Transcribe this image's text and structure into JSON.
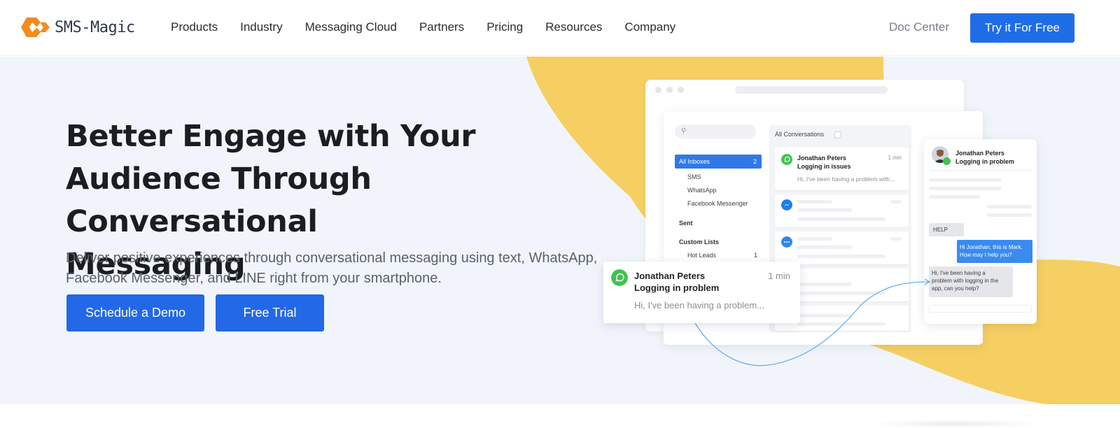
{
  "brand": {
    "name": "SMS-Magic",
    "accent": "#1f6de6",
    "logo_orange": "#f28c1e",
    "blob_yellow": "#f6cf63",
    "hero_bg": "#f1f5fb"
  },
  "nav": {
    "links": [
      "Products",
      "Industry",
      "Messaging Cloud",
      "Partners",
      "Pricing",
      "Resources",
      "Company"
    ],
    "doc_center": "Doc Center",
    "cta": "Try it For Free"
  },
  "hero": {
    "title_lines": [
      "Better Engage with Your",
      "Audience Through Conversational",
      "Messaging"
    ],
    "subtitle_lines": [
      "Deliver positive experiences through conversational messaging using text, WhatsApp,",
      "Facebook Messenger, and LINE right from your smartphone."
    ],
    "buttons": {
      "demo": "Schedule a Demo",
      "trial": "Free Trial"
    }
  },
  "illustration": {
    "sidebar": {
      "active_label": "All Inboxes",
      "active_count": "2",
      "channels": [
        "SMS",
        "WhatsApp",
        "Facebook Messenger"
      ],
      "sent": "Sent",
      "custom_lists": "Custom Lists",
      "hot_leads": "Hot Leads",
      "hot_leads_count": "1"
    },
    "conversations": {
      "header": "All Conversations",
      "first": {
        "name": "Jonathan Peters",
        "subject": "Logging in issues",
        "time": "1 min",
        "preview": "Hi, I've been having a problem with..."
      },
      "icons": [
        "whatsapp-icon",
        "messenger-icon",
        "chat-icon"
      ]
    },
    "chat": {
      "name": "Jonathan Peters",
      "subject": "Logging in problem",
      "help": "HELP",
      "agent_lines": [
        "Hi Jonathan, this is Mark.",
        "How may I help you?"
      ],
      "user_lines": [
        "Hi, I've been having a",
        "problem with logging in the",
        "app, can you help?"
      ]
    },
    "notification": {
      "name": "Jonathan Peters",
      "subject": "Logging in problem",
      "time": "1 min",
      "preview": "Hi, I've been having a problem..."
    }
  }
}
